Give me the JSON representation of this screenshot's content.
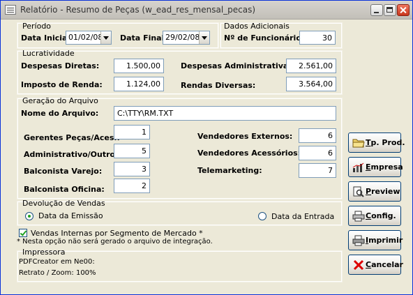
{
  "window": {
    "title": "Relatório - Resumo de Peças (w_ead_res_mensal_pecas)"
  },
  "periodo": {
    "legend": "Período",
    "data_inicial_label": "Data Inicial:",
    "data_inicial": "01/02/08",
    "data_final_label": "Data Final:",
    "data_final": "29/02/08"
  },
  "dados_adicionais": {
    "legend": "Dados Adicionais",
    "funcionarios_label": "Nº de Funcionários:",
    "funcionarios": "30"
  },
  "lucratividade": {
    "legend": "Lucratividade",
    "despesas_diretas_label": "Despesas Diretas:",
    "despesas_diretas": "1.500,00",
    "imposto_renda_label": "Imposto de Renda:",
    "imposto_renda": "1.124,00",
    "despesas_adm_label": "Despesas Administrativas:",
    "despesas_adm": "2.561,00",
    "rendas_diversas_label": "Rendas Diversas:",
    "rendas_diversas": "3.564,00"
  },
  "geracao": {
    "legend": "Geração do Arquivo",
    "nome_label": "Nome do Arquivo:",
    "nome": "C:\\TTY\\RM.TXT",
    "gerentes_label": "Gerentes Peças/Aces.:",
    "gerentes": "1",
    "administrativo_label": "Administrativo/Outros:",
    "administrativo": "5",
    "balconista_varejo_label": "Balconista Varejo:",
    "balconista_varejo": "3",
    "balconista_oficina_label": "Balconista Oficina:",
    "balconista_oficina": "2",
    "vend_externos_label": "Vendedores Externos:",
    "vend_externos": "6",
    "vend_acessorios_label": "Vendedores Acessórios:",
    "vend_acessorios": "6",
    "telemarketing_label": "Telemarketing:",
    "telemarketing": "7"
  },
  "devolucao": {
    "legend": "Devolução de Vendas",
    "opt_emissao": "Data da Emissão",
    "opt_entrada": "Data da Entrada",
    "selected": "emissao"
  },
  "vendas_internas": {
    "label": "Vendas Internas por Segmento de Mercado *",
    "checked": true,
    "note": "* Nesta opção não será gerado o arquivo de integração."
  },
  "impressora": {
    "legend": "Impressora",
    "printer": "PDFCreator em Ne00:",
    "zoom": "Retrato / Zoom: 100%"
  },
  "buttons": {
    "tp_prod": "Tp. Prod.",
    "empresa": "Empresa",
    "preview": "Preview",
    "config": "Config.",
    "imprimir": "Imprimir",
    "cancelar": "Cancelar"
  }
}
